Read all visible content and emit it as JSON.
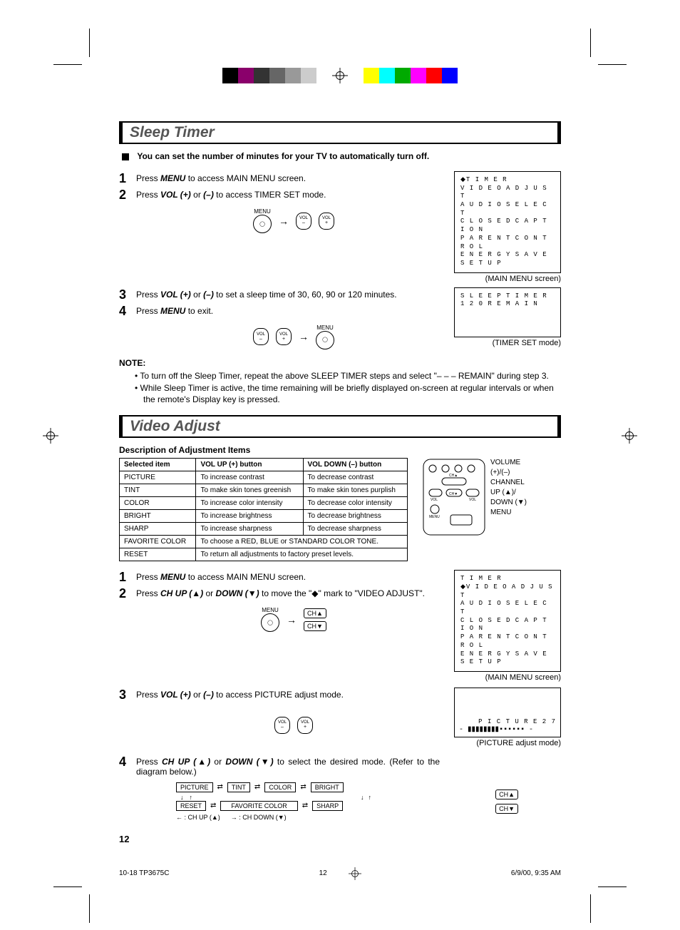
{
  "colorbar_colors": [
    "#000",
    "#8a006b",
    "#333",
    "#666",
    "#999",
    "#ccc",
    "#fff",
    "#fff",
    "#fff",
    "#ff0",
    "#0ff",
    "#0a0",
    "#f0f",
    "#f00",
    "#00f"
  ],
  "sleep": {
    "title": "Sleep Timer",
    "lead": "You can set the number of minutes for your TV to automatically turn off.",
    "steps12": {
      "s1_pre": "Press ",
      "s1_key": "MENU",
      "s1_post": " to access MAIN MENU screen.",
      "s2_pre": "Press ",
      "s2_k1": "VOL (+)",
      "s2_mid": " or ",
      "s2_k2": "(–)",
      "s2_post": " to access TIMER SET mode."
    },
    "btns1": {
      "menu": "MENU",
      "volm": "VOL –",
      "volp": "VOL +"
    },
    "osd1": [
      "◆T I M E R",
      "  V I D E O   A D J U S T",
      "  A U D I O   S E L E C T",
      "  C L O S E D   C A P T I O N",
      "  P A R E N T   C O N T R O L",
      "  E N E R G Y   S A V E",
      "  S E T   U P"
    ],
    "osd1_cap": "(MAIN MENU screen)",
    "steps34": {
      "s3_pre": "Press ",
      "s3_k1": "VOL (+)",
      "s3_mid": " or ",
      "s3_k2": "(–)",
      "s3_post": " to set a sleep time of 30, 60, 90 or 120 minutes.",
      "s4_pre": "Press ",
      "s4_key": "MENU",
      "s4_post": " to exit."
    },
    "osd2": [
      "S L E E P   T I M E R",
      "        1 2 0   R E M A I N"
    ],
    "osd2_cap": "(TIMER SET mode)",
    "note_h": "NOTE:",
    "notes": [
      "To turn off the Sleep Timer, repeat the above SLEEP TIMER steps and select \"– – – REMAIN\" during step 3.",
      "While Sleep Timer is active, the time remaining will be briefly displayed on-screen at regular intervals or when the remote's Display key is pressed."
    ]
  },
  "video": {
    "title": "Video Adjust",
    "sub": "Description of Adjustment Items",
    "table": {
      "headers": [
        "Selected item",
        "VOL UP (+) button",
        "VOL DOWN (–) button"
      ],
      "rows": [
        [
          "PICTURE",
          "To increase contrast",
          "To decrease contrast"
        ],
        [
          "TINT",
          "To make skin tones greenish",
          "To make skin tones purplish"
        ],
        [
          "COLOR",
          "To increase color intensity",
          "To decrease color intensity"
        ],
        [
          "BRIGHT",
          "To increase brightness",
          "To decrease brightness"
        ],
        [
          "SHARP",
          "To increase sharpness",
          "To decrease sharpness"
        ],
        [
          "FAVORITE COLOR",
          {
            "colspan": 2,
            "text": "To choose a RED, BLUE or STANDARD COLOR TONE."
          }
        ],
        [
          "RESET",
          {
            "colspan": 2,
            "text": "To return all adjustments to factory preset levels."
          }
        ]
      ]
    },
    "remote_labels": [
      "VOLUME",
      "(+)/(–)",
      "",
      "CHANNEL",
      "UP (▲)/",
      "DOWN (▼)",
      "MENU"
    ],
    "step1": {
      "pre": "Press ",
      "key": "MENU",
      "post": " to access MAIN MENU screen."
    },
    "step2": {
      "pre": "Press ",
      "k1": "CH UP (▲)",
      "mid": " or ",
      "k2": "DOWN (▼)",
      "post": " to move the \"◆\" mark to \"VIDEO ADJUST\"."
    },
    "ch_up": "CH▲",
    "ch_dn": "CH▼",
    "osd3": [
      "  T I M E R",
      "◆V I D E O   A D J U S T",
      "  A U D I O   S E L E C T",
      "  C L O S E D   C A P T I O N",
      "  P A R E N T   C O N T R O L",
      "  E N E R G Y   S A V E",
      "  S E T   U P"
    ],
    "osd3_cap": "(MAIN MENU screen)",
    "step3": {
      "pre": "Press ",
      "k1": "VOL (+)",
      "mid": " or ",
      "k2": "(–)",
      "post": " to access PICTURE adjust mode."
    },
    "osd4_line1": "P I C T U R E     2 7",
    "osd4_bar": "- ▮▮▮▮▮▮▮▮▪▪▪▪▪▪ -",
    "osd4_cap": "(PICTURE adjust mode)",
    "step4": {
      "pre": "Press ",
      "k1": "CH UP (▲)",
      "mid": " or ",
      "k2": "DOWN (▼)",
      "post": " to select the desired mode. (Refer to the diagram below.)"
    },
    "flow": [
      "PICTURE",
      "TINT",
      "COLOR",
      "BRIGHT",
      "RESET",
      "FAVORITE COLOR",
      "SHARP"
    ],
    "legend_l": "← : CH UP (▲)",
    "legend_r": "→ : CH DOWN (▼)"
  },
  "page_num": "12",
  "footer": {
    "file": "10-18 TP3675C",
    "pg": "12",
    "date": "6/9/00, 9:35 AM"
  }
}
